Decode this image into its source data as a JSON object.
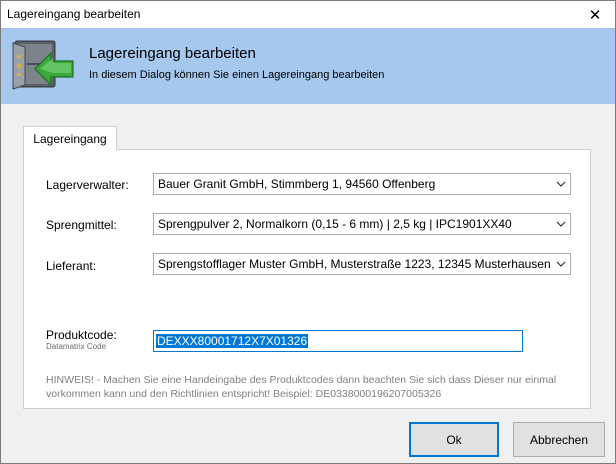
{
  "window": {
    "title": "Lagereingang bearbeiten",
    "close_label": "✕"
  },
  "header": {
    "title": "Lagereingang bearbeiten",
    "subtitle": "In diesem Dialog können Sie einen Lagereingang bearbeiten",
    "icon": "safe-with-green-arrow-icon"
  },
  "tabs": [
    {
      "label": "Lagereingang",
      "active": true
    }
  ],
  "form": {
    "lagerverwalter": {
      "label": "Lagerverwalter:",
      "value": "Bauer Granit GmbH, Stimmberg 1, 94560 Offenberg"
    },
    "sprengmittel": {
      "label": "Sprengmittel:",
      "value": "Sprengpulver 2, Normalkorn (0,15 - 6 mm) | 2,5 kg | IPC1901XX40"
    },
    "lieferant": {
      "label": "Lieferant:",
      "value": "Sprengstofflager Muster GmbH, Musterstraße 1223, 12345 Musterhausen"
    },
    "produktcode": {
      "label": "Produktcode:",
      "sublabel": "Datamatrix Code",
      "value": "DEXXX80001712X7X01326"
    },
    "hint": "HINWEIS! - Machen Sie eine Handeingabe des Produktcodes dann beachten Sie sich dass Dieser nur einmal vorkommen kann und den Richtlinien entspricht! Beispiel: DE0338000196207005326"
  },
  "buttons": {
    "ok": "Ok",
    "cancel": "Abbrechen"
  },
  "colors": {
    "header_bg": "#a6c8ee",
    "accent": "#0078d7"
  }
}
